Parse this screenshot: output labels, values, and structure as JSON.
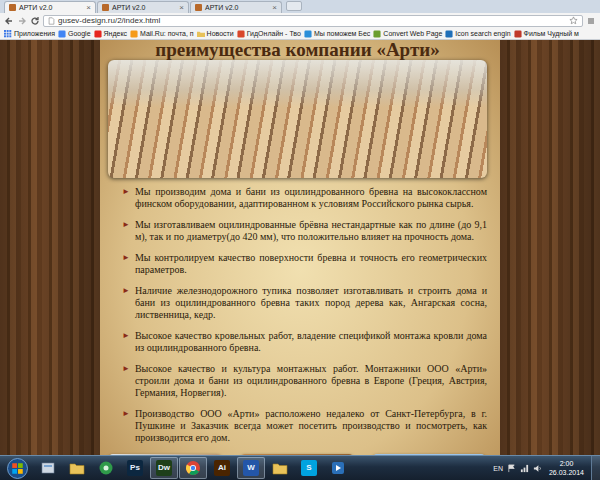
{
  "browser": {
    "tabs": [
      {
        "title": "АРТИ v2.0",
        "selected": true
      },
      {
        "title": "АРТИ v2.0",
        "selected": false
      },
      {
        "title": "АРТИ v2.0",
        "selected": false
      }
    ],
    "tab_close": "×",
    "address": "gusev-design.ru/2/index.html",
    "bookmarks": [
      {
        "label": "Приложения",
        "kind": "apps",
        "color": "#3b78e7"
      },
      {
        "label": "Google",
        "kind": "site",
        "color": "#4285f4"
      },
      {
        "label": "Яндекс",
        "kind": "site",
        "color": "#e52620"
      },
      {
        "label": "Mail.Ru: почта, п",
        "kind": "site",
        "color": "#f59b1a"
      },
      {
        "label": "Новости",
        "kind": "folder",
        "color": "#e8c25a"
      },
      {
        "label": "ГидОнлайн - Тво",
        "kind": "site",
        "color": "#d9472b"
      },
      {
        "label": "Мы поможем Бес",
        "kind": "site",
        "color": "#2b8fd9"
      },
      {
        "label": "Convert Web Page",
        "kind": "site",
        "color": "#6a9e2e"
      },
      {
        "label": "Icon search engin",
        "kind": "site",
        "color": "#1f6fb8"
      },
      {
        "label": "Фильм Чудный м",
        "kind": "site",
        "color": "#c0392b"
      }
    ]
  },
  "page": {
    "heading": "преимущества компании «Арти»",
    "bullet": "►",
    "advantages": [
      "Мы производим дома и бани из оцилиндрованного бревна на высококлассном финском оборудовании, адаптированном к условиям Российского рынка сырья.",
      "Мы изготавливаем оцилиндрованные брёвна нестандартные как по длине (до 9,1 м), так и по диаметру(до 420 мм), что положительно влияет на прочность дома.",
      "Мы контролируем качество поверхности бревна и точность его геометрических параметров.",
      "Наличие железнодорожного тупика позволяет изготавливать и строить дома и бани из оцилиндрованного бревна таких пород дерева как, Ангарская сосна, лиственница, кедр.",
      "Высокое качество кровельных работ, владение спецификой монтажа кровли дома из оцилиндрованного бревна.",
      "Высокое качество и культура монтажных работ. Монтажники ООО «Арти» строили дома и бани из оцилиндрованного бревна в Европе (Греция, Австрия, Германия, Норвегия).",
      "Производство ООО «Арти» расположено недалеко от Санкт-Петербурга, в г. Пушкине и Заказчик всегда может посетить производство и посмотреть, как производится его дом."
    ]
  },
  "taskbar": {
    "apps": [
      {
        "kind": "library",
        "active": false
      },
      {
        "kind": "folder",
        "active": false
      },
      {
        "kind": "disc",
        "active": false
      },
      {
        "kind": "letter",
        "label": "Ps",
        "color": "#0c2740",
        "active": false
      },
      {
        "kind": "letter",
        "label": "Dw",
        "color": "#1e3f1a",
        "active": true
      },
      {
        "kind": "chrome",
        "active": true
      },
      {
        "kind": "letter",
        "label": "Ai",
        "color": "#4a2400",
        "active": false
      },
      {
        "kind": "letter",
        "label": "W",
        "color": "#2356a8",
        "active": true
      },
      {
        "kind": "folder",
        "active": false
      },
      {
        "kind": "letter",
        "label": "S",
        "color": "#00a3e0",
        "active": false
      },
      {
        "kind": "media",
        "active": false
      }
    ],
    "language": "EN",
    "time": "2:00",
    "date": "26.03.2014"
  }
}
